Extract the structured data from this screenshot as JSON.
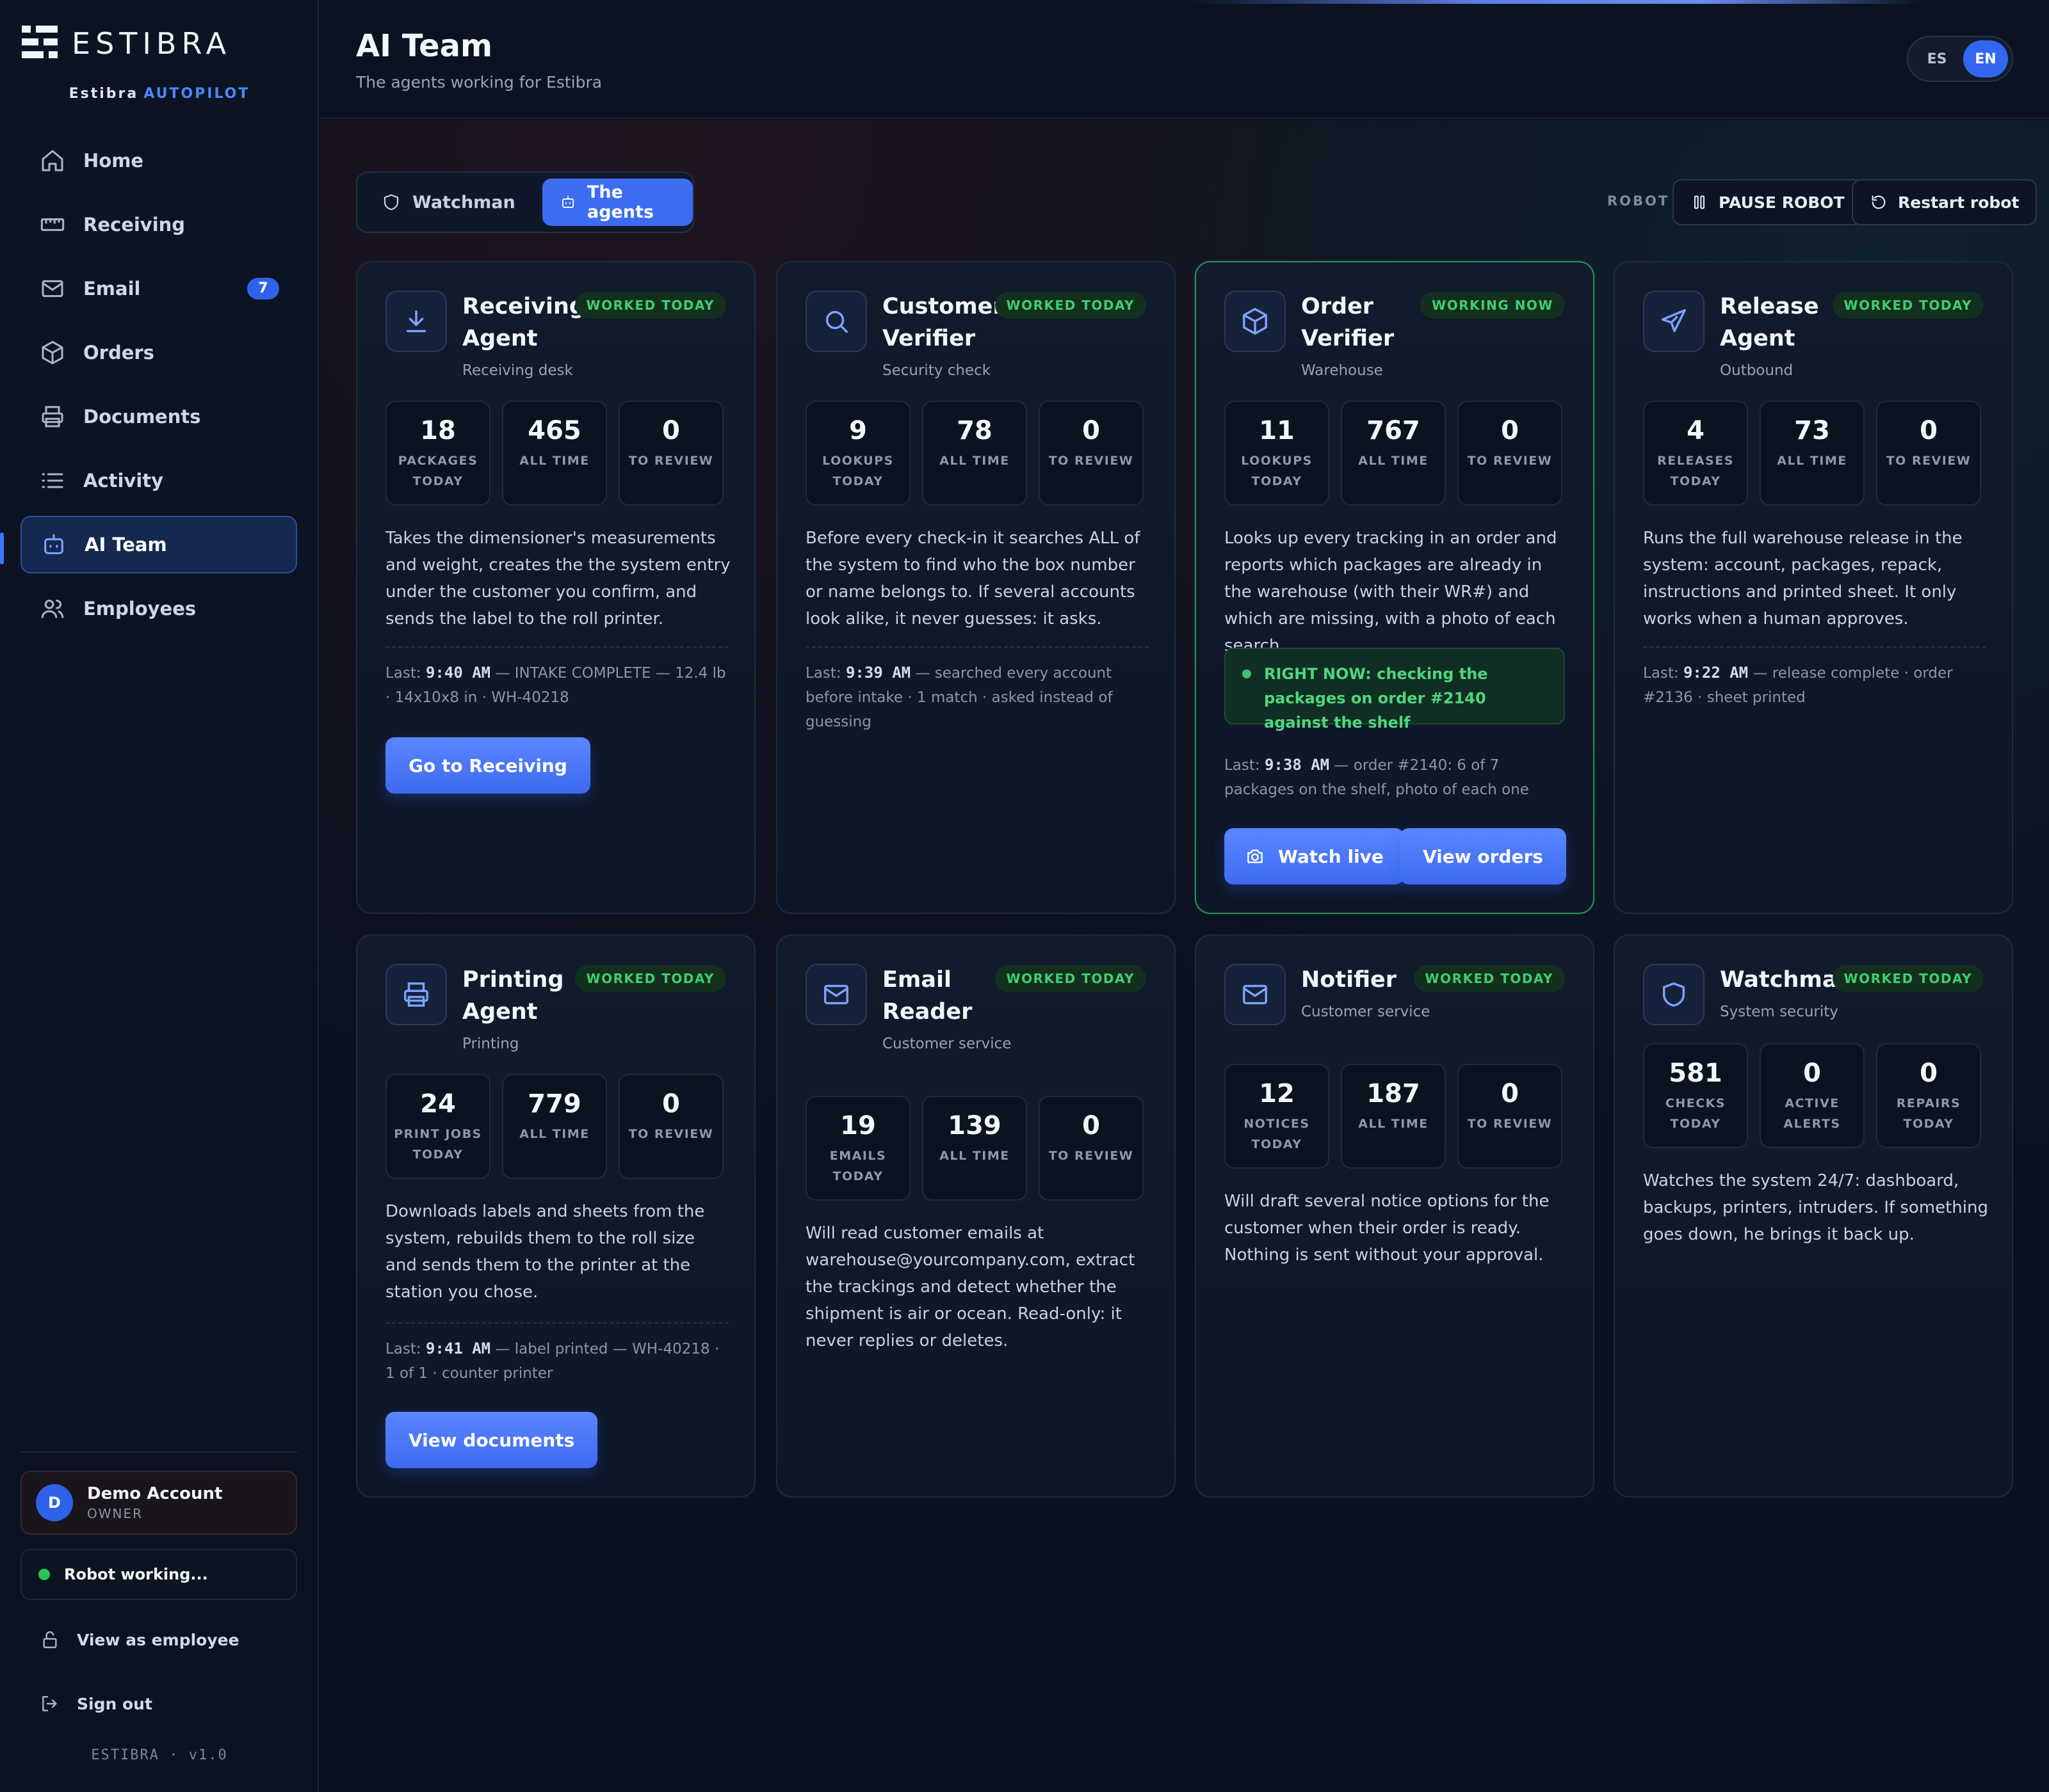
{
  "brand": {
    "name": "ESTIBRA",
    "sub_prefix": "Estibra",
    "sub_accent": "AUTOPILOT",
    "version": "ESTIBRA · v1.0"
  },
  "nav": [
    {
      "label": "Home",
      "icon": "home-icon"
    },
    {
      "label": "Receiving",
      "icon": "ruler-icon"
    },
    {
      "label": "Email",
      "icon": "mail-icon",
      "badge": "7"
    },
    {
      "label": "Orders",
      "icon": "box-icon"
    },
    {
      "label": "Documents",
      "icon": "printer-icon"
    },
    {
      "label": "Activity",
      "icon": "list-icon"
    },
    {
      "label": "AI Team",
      "icon": "robot-icon",
      "active": true
    },
    {
      "label": "Employees",
      "icon": "users-icon"
    }
  ],
  "account": {
    "initial": "D",
    "name": "Demo Account",
    "role": "OWNER"
  },
  "robot_status": "Robot working...",
  "side_links": {
    "view_as_employee": "View as employee",
    "sign_out": "Sign out"
  },
  "header": {
    "title": "AI Team",
    "subtitle": "The agents working for Estibra",
    "lang": [
      "ES",
      "EN"
    ],
    "lang_selected": "EN"
  },
  "tabs": {
    "watchman": "Watchman",
    "agents": "The agents",
    "selected": "The agents"
  },
  "robot_controls": {
    "label": "ROBOT",
    "pause": "PAUSE ROBOT",
    "restart": "Restart robot"
  },
  "colors": {
    "accent": "#3b6cf2",
    "status_green": "#3fcf6d",
    "background": "#0a111e"
  },
  "agents": [
    {
      "name": "Receiving Agent",
      "role": "Receiving desk",
      "status": "WORKED TODAY",
      "icon": "download-icon",
      "stats": [
        {
          "value": "18",
          "label": "PACKAGES TODAY"
        },
        {
          "value": "465",
          "label": "ALL TIME"
        },
        {
          "value": "0",
          "label": "TO REVIEW"
        }
      ],
      "description": "Takes the dimensioner's measurements and weight, creates the the system entry under the customer you confirm, and sends the label to the roll printer.",
      "last_prefix": "Last:",
      "last_time": "9:40 AM",
      "last_text": " — INTAKE COMPLETE — 12.4 lb · 14x10x8 in · WH-40218",
      "buttons": [
        "Go to Receiving"
      ]
    },
    {
      "name": "Customer Verifier",
      "role": "Security check",
      "status": "WORKED TODAY",
      "icon": "search-icon",
      "stats": [
        {
          "value": "9",
          "label": "LOOKUPS TODAY"
        },
        {
          "value": "78",
          "label": "ALL TIME"
        },
        {
          "value": "0",
          "label": "TO REVIEW"
        }
      ],
      "description": "Before every check-in it searches ALL of the system to find who the box number or name belongs to. If several accounts look alike, it never guesses: it asks.",
      "last_prefix": "Last:",
      "last_time": "9:39 AM",
      "last_text": " — searched every account before intake · 1 match · asked instead of guessing",
      "buttons": []
    },
    {
      "name": "Order Verifier",
      "role": "Warehouse",
      "status": "WORKING NOW",
      "icon": "box-icon",
      "stats": [
        {
          "value": "11",
          "label": "LOOKUPS TODAY"
        },
        {
          "value": "767",
          "label": "ALL TIME"
        },
        {
          "value": "0",
          "label": "TO REVIEW"
        }
      ],
      "description": "Looks up every tracking in an order and reports which packages are already in the warehouse (with their WR#) and which are missing, with a photo of each search.",
      "right_now": "RIGHT NOW: checking the packages on order #2140 against the shelf",
      "last_prefix": "Last:",
      "last_time": "9:38 AM",
      "last_text": " — order #2140: 6 of 7 packages on the shelf, photo of each one",
      "buttons": [
        "Watch live",
        "View orders"
      ]
    },
    {
      "name": "Release Agent",
      "role": "Outbound",
      "status": "WORKED TODAY",
      "icon": "plane-icon",
      "stats": [
        {
          "value": "4",
          "label": "RELEASES TODAY"
        },
        {
          "value": "73",
          "label": "ALL TIME"
        },
        {
          "value": "0",
          "label": "TO REVIEW"
        }
      ],
      "description": "Runs the full warehouse release in the system: account, packages, repack, instructions and printed sheet. It only works when a human approves.",
      "last_prefix": "Last:",
      "last_time": "9:22 AM",
      "last_text": " — release complete · order #2136 · sheet printed",
      "buttons": []
    },
    {
      "name": "Printing Agent",
      "role": "Printing",
      "status": "WORKED TODAY",
      "icon": "printer-icon",
      "stats": [
        {
          "value": "24",
          "label": "PRINT JOBS TODAY"
        },
        {
          "value": "779",
          "label": "ALL TIME"
        },
        {
          "value": "0",
          "label": "TO REVIEW"
        }
      ],
      "description": "Downloads labels and sheets from the system, rebuilds them to the roll size and sends them to the printer at the station you chose.",
      "last_prefix": "Last:",
      "last_time": "9:41 AM",
      "last_text": " — label printed — WH-40218 · 1 of 1 · counter printer",
      "buttons": [
        "View documents"
      ]
    },
    {
      "name": "Email Reader",
      "role": "Customer service",
      "status": "WORKED TODAY",
      "icon": "mail-icon",
      "stats": [
        {
          "value": "19",
          "label": "EMAILS TODAY"
        },
        {
          "value": "139",
          "label": "ALL TIME"
        },
        {
          "value": "0",
          "label": "TO REVIEW"
        }
      ],
      "description": "Will read customer emails at warehouse@yourcompany.com, extract the trackings and detect whether the shipment is air or ocean. Read-only: it never replies or deletes.",
      "buttons": []
    },
    {
      "name": "Notifier",
      "role": "Customer service",
      "status": "WORKED TODAY",
      "icon": "mail-icon",
      "stats": [
        {
          "value": "12",
          "label": "NOTICES TODAY"
        },
        {
          "value": "187",
          "label": "ALL TIME"
        },
        {
          "value": "0",
          "label": "TO REVIEW"
        }
      ],
      "description": "Will draft several notice options for the customer when their order is ready. Nothing is sent without your approval.",
      "buttons": []
    },
    {
      "name": "Watchman",
      "role": "System security",
      "status": "WORKED TODAY",
      "icon": "shield-icon",
      "stats": [
        {
          "value": "581",
          "label": "CHECKS TODAY"
        },
        {
          "value": "0",
          "label": "ACTIVE ALERTS"
        },
        {
          "value": "0",
          "label": "REPAIRS TODAY"
        }
      ],
      "description": "Watches the system 24/7: dashboard, backups, printers, intruders. If something goes down, he brings it back up.",
      "buttons": []
    }
  ]
}
